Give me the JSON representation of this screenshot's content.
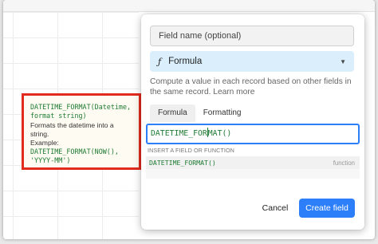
{
  "tooltip": {
    "signature_line1": "DATETIME_FORMAT(Datetime,",
    "signature_line2": "format string)",
    "description": "Formats the datetime into a string.",
    "example_label": "Example:",
    "example_line1": "DATETIME_FORMAT(NOW(),",
    "example_line2": "'YYYY-MM')"
  },
  "field": {
    "name_placeholder": "Field name (optional)",
    "type_label": "Formula",
    "type_icon": "function-icon",
    "help_text": "Compute a value in each record based on other fields in the same record.",
    "learn_more": "Learn more"
  },
  "tabs": [
    {
      "label": "Formula",
      "active": true
    },
    {
      "label": "Formatting",
      "active": false
    }
  ],
  "editor": {
    "before_cursor": "DATETIME_FOR",
    "after_cursor": "MAT()"
  },
  "insert": {
    "header": "INSERT A FIELD OR FUNCTION",
    "suggestions": [
      {
        "name": "DATETIME_FORMAT()",
        "kind": "function"
      }
    ]
  },
  "actions": {
    "cancel": "Cancel",
    "create": "Create field"
  },
  "colors": {
    "accent": "#2d7ff9",
    "highlight_border": "#e02b1d",
    "formula_text": "#1e7a32",
    "type_bg": "#dbeefc"
  }
}
